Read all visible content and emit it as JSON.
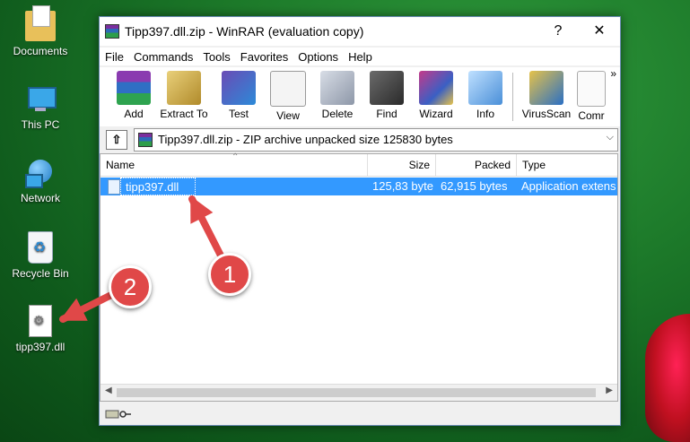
{
  "desktop": {
    "icons": [
      {
        "label": "Documents"
      },
      {
        "label": "This PC"
      },
      {
        "label": "Network"
      },
      {
        "label": "Recycle Bin"
      },
      {
        "label": "tipp397.dll"
      }
    ]
  },
  "window": {
    "title": "Tipp397.dll.zip - WinRAR (evaluation copy)",
    "help_glyph": "?",
    "close_glyph": "✕"
  },
  "menu": [
    "File",
    "Commands",
    "Tools",
    "Favorites",
    "Options",
    "Help"
  ],
  "toolbar": {
    "buttons": [
      {
        "label": "Add",
        "icon": "add-icon"
      },
      {
        "label": "Extract To",
        "icon": "extract-icon"
      },
      {
        "label": "Test",
        "icon": "test-icon"
      },
      {
        "label": "View",
        "icon": "view-icon"
      },
      {
        "label": "Delete",
        "icon": "delete-icon"
      },
      {
        "label": "Find",
        "icon": "find-icon"
      },
      {
        "label": "Wizard",
        "icon": "wizard-icon"
      },
      {
        "label": "Info",
        "icon": "info-icon"
      },
      {
        "label": "VirusScan",
        "icon": "virusscan-icon"
      },
      {
        "label": "Comr",
        "icon": "comment-icon"
      }
    ],
    "overflow": "»"
  },
  "address": {
    "text": "Tipp397.dll.zip - ZIP archive unpacked size 125830 bytes",
    "up_glyph": "⇧",
    "dropdown_glyph": "⌵"
  },
  "columns": [
    "Name",
    "Size",
    "Packed",
    "Type"
  ],
  "files": [
    {
      "name": "tipp397.dll",
      "size": "125,83 byte",
      "packed": "62,915 bytes",
      "type": "Application extens"
    }
  ],
  "annotations": {
    "badge1": "1",
    "badge2": "2",
    "arrow_color": "#e04848"
  }
}
